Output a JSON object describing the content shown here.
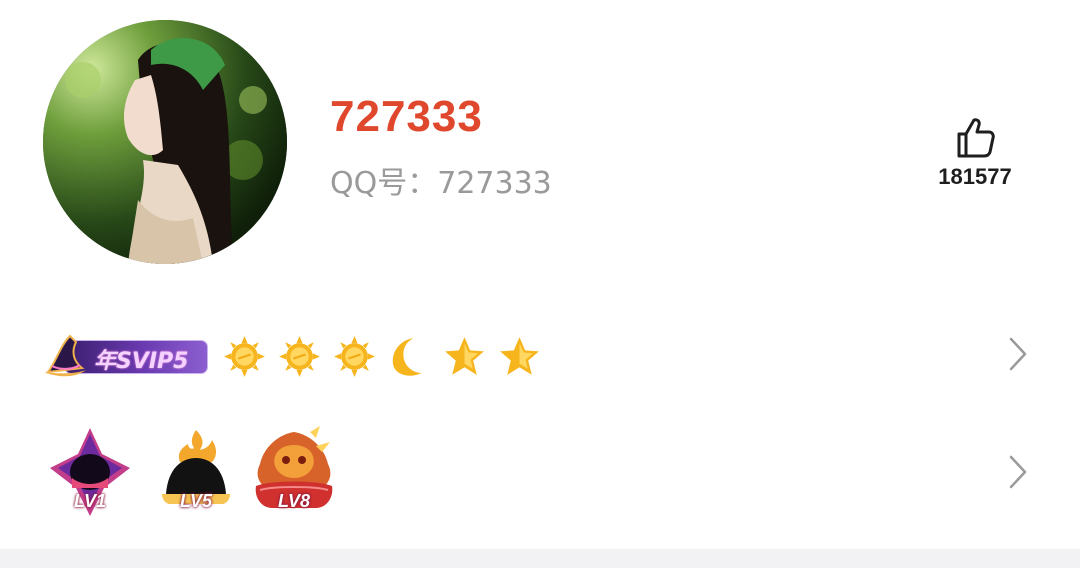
{
  "profile": {
    "nickname": "727333",
    "qq_line": "QQ号：727333",
    "avatar_icon": "avatar-photo"
  },
  "likes": {
    "icon": "thumbs-up-icon",
    "count": "181577"
  },
  "vip": {
    "badge_text": "年SVIP5",
    "level_icons": [
      "sun-icon",
      "sun-icon",
      "sun-icon",
      "moon-icon",
      "star-icon",
      "star-icon"
    ],
    "chevron": "chevron-right-icon"
  },
  "medals": {
    "items": [
      {
        "label": "LV1",
        "icon": "purple-medal-icon"
      },
      {
        "label": "LV5",
        "icon": "black-flame-medal-icon"
      },
      {
        "label": "LV8",
        "icon": "dragon-medal-icon"
      }
    ],
    "chevron": "chevron-right-icon"
  },
  "colors": {
    "nickname": "#e0482d",
    "secondary_text": "#9a9a9a",
    "badge_gold": "#f6b51d",
    "vip_purple": "#6a3ab0"
  }
}
